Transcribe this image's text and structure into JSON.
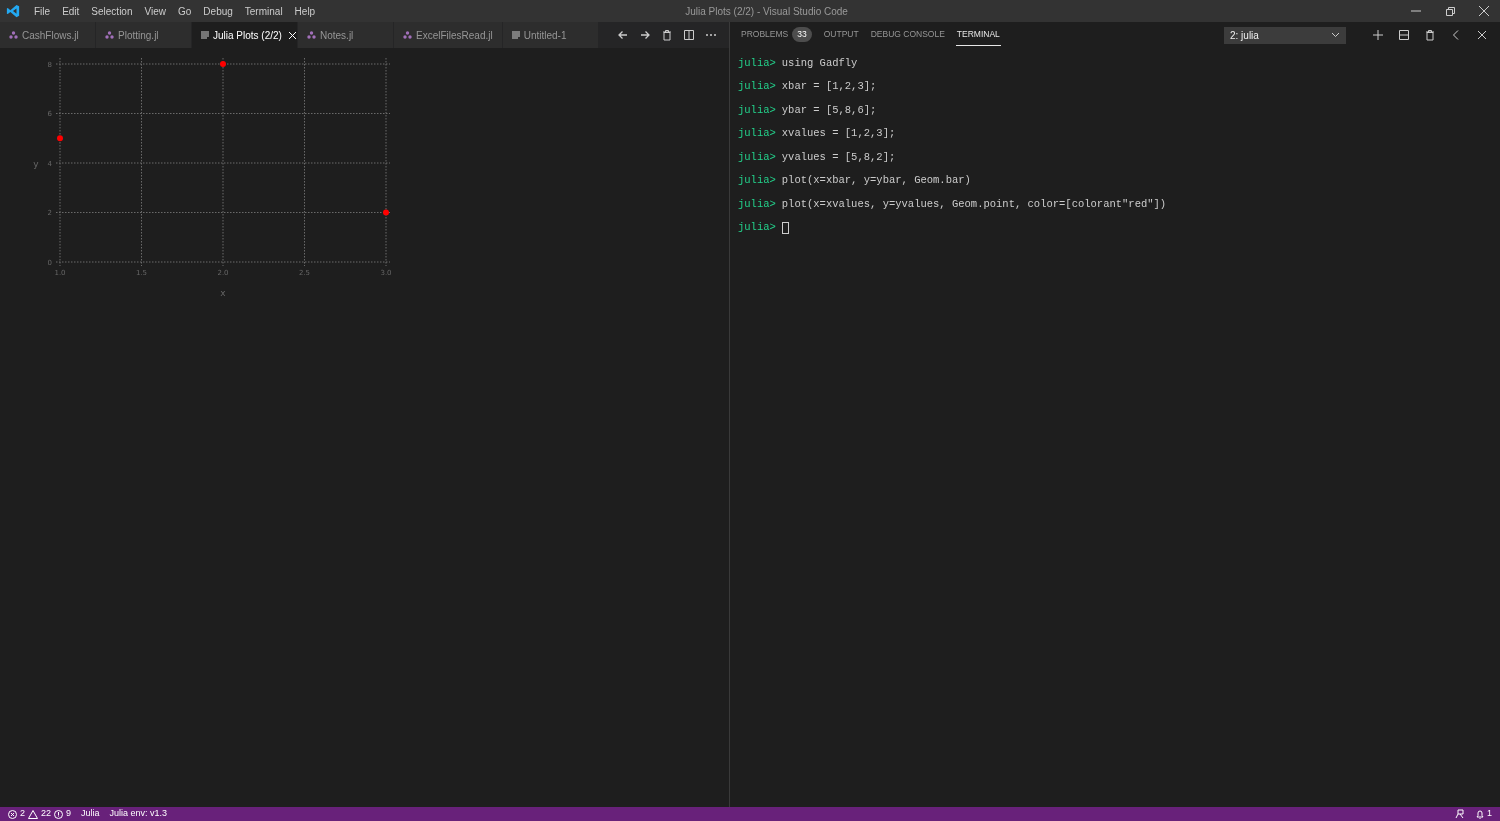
{
  "window": {
    "title": "Julia Plots (2/2) - Visual Studio Code"
  },
  "menu": [
    "File",
    "Edit",
    "Selection",
    "View",
    "Go",
    "Debug",
    "Terminal",
    "Help"
  ],
  "editor_tabs": [
    {
      "label": "CashFlows.jl",
      "kind": "julia",
      "selected": false
    },
    {
      "label": "Plotting.jl",
      "kind": "julia",
      "selected": false
    },
    {
      "label": "Julia Plots (2/2)",
      "kind": "plot",
      "selected": true
    },
    {
      "label": "Notes.jl",
      "kind": "julia",
      "selected": false
    },
    {
      "label": "ExcelFilesRead.jl",
      "kind": "julia",
      "selected": false
    },
    {
      "label": "Untitled-1",
      "kind": "plot",
      "selected": false
    }
  ],
  "plot": {
    "chart_data": {
      "type": "scatter",
      "xlabel": "x",
      "ylabel": "y",
      "xlim": [
        1,
        3
      ],
      "ylim": [
        0,
        8
      ],
      "xticks": [
        {
          "value": 1,
          "label": "1.0"
        },
        {
          "value": 1.5,
          "label": "1.5"
        },
        {
          "value": 2,
          "label": "2.0"
        },
        {
          "value": 2.5,
          "label": "2.5"
        },
        {
          "value": 3,
          "label": "3.0"
        }
      ],
      "yticks": [
        0,
        2,
        4,
        6,
        8
      ],
      "x": [
        1,
        2,
        3
      ],
      "grid": true,
      "series": [
        {
          "color": "#ff0000",
          "values": [
            5,
            8,
            2
          ]
        }
      ]
    }
  },
  "panel": {
    "tabs": [
      {
        "label": "PROBLEMS",
        "badge": "33",
        "selected": false
      },
      {
        "label": "OUTPUT",
        "selected": false
      },
      {
        "label": "DEBUG CONSOLE",
        "selected": false
      },
      {
        "label": "TERMINAL",
        "selected": true
      }
    ],
    "terminal_select": "2: julia",
    "lines": [
      {
        "prompt": "julia>",
        "command": "using Gadfly"
      },
      {
        "prompt": "julia>",
        "command": "xbar = [1,2,3];"
      },
      {
        "prompt": "julia>",
        "command": "ybar = [5,8,6];"
      },
      {
        "prompt": "julia>",
        "command": "xvalues = [1,2,3];"
      },
      {
        "prompt": "julia>",
        "command": "yvalues = [5,8,2];"
      },
      {
        "prompt": "julia>",
        "command": "plot(x=xbar, y=ybar, Geom.bar)"
      },
      {
        "prompt": "julia>",
        "command": "plot(x=xvalues, y=yvalues, Geom.point, color=[colorant\"red\"])"
      },
      {
        "prompt": "julia>"
      }
    ]
  },
  "status_bar": {
    "errors": "2",
    "warnings": "22",
    "infos": "9",
    "items": [
      "Julia",
      "Julia env: v1.3"
    ],
    "notifications": "1"
  }
}
